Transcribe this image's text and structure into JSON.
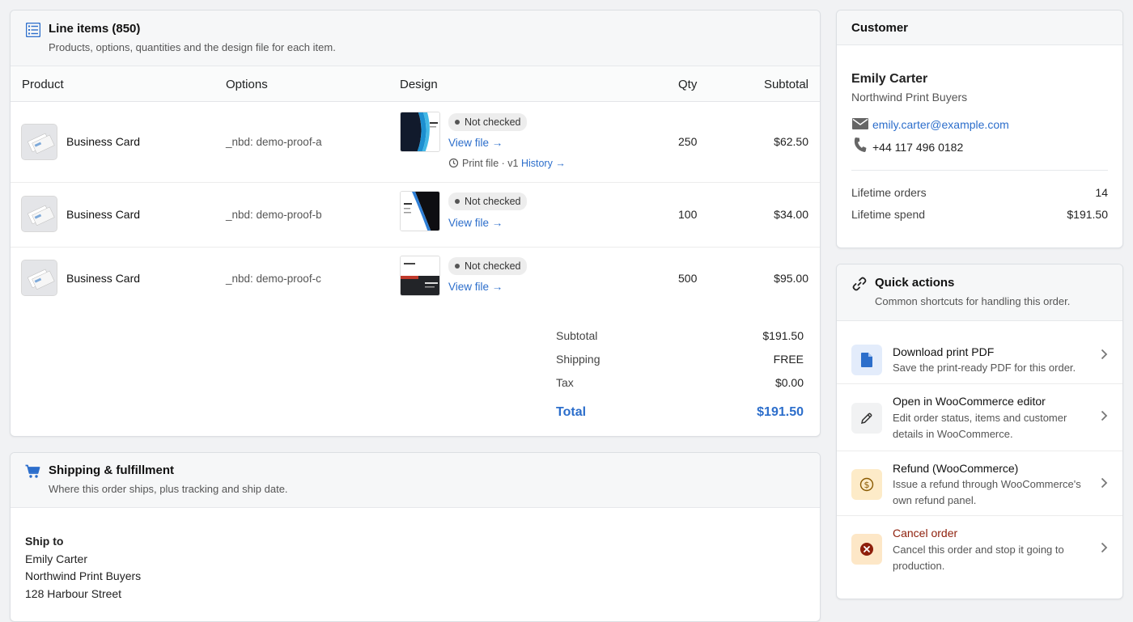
{
  "line_items": {
    "title": "Line items (850)",
    "subtitle": "Products, options, quantities and the design file for each item.",
    "columns": [
      "Product",
      "Options",
      "Design",
      "Qty",
      "Subtotal"
    ],
    "rows": [
      {
        "product": "Business Card",
        "option": "_nbd: demo-proof-a",
        "status": "Not checked",
        "view": "View file →",
        "meta_prefix": "Print file · v1",
        "meta_link": "History →",
        "qty": "250",
        "subtotal": "$62.50"
      },
      {
        "product": "Business Card",
        "option": "_nbd: demo-proof-b",
        "status": "Not checked",
        "view": "View file →",
        "qty": "100",
        "subtotal": "$34.00"
      },
      {
        "product": "Business Card",
        "option": "_nbd: demo-proof-c",
        "status": "Not checked",
        "view": "View file →",
        "qty": "500",
        "subtotal": "$95.00"
      }
    ],
    "totals": {
      "subtotal_label": "Subtotal",
      "subtotal": "$191.50",
      "shipping_label": "Shipping",
      "shipping": "FREE",
      "tax_label": "Tax",
      "tax": "$0.00",
      "total_label": "Total",
      "total": "$191.50"
    }
  },
  "shipping": {
    "title": "Shipping & fulfillment",
    "subtitle": "Where this order ships, plus tracking and ship date.",
    "ship_to_label": "Ship to",
    "lines": [
      "Emily Carter",
      "Northwind Print Buyers",
      "128 Harbour Street"
    ]
  },
  "customer": {
    "title": "Customer",
    "name": "Emily Carter",
    "company": "Northwind Print Buyers",
    "email": "emily.carter@example.com",
    "phone": "+44 117 496 0182",
    "lifetime_orders_label": "Lifetime orders",
    "lifetime_orders": "14",
    "lifetime_spend_label": "Lifetime spend",
    "lifetime_spend": "$191.50"
  },
  "quick_actions": {
    "title": "Quick actions",
    "subtitle": "Common shortcuts for handling this order.",
    "items": [
      {
        "title": "Download print PDF",
        "desc": "Save the print-ready PDF for this order.",
        "icon": "document-icon"
      },
      {
        "title": "Open in WooCommerce editor",
        "desc": "Edit order status, items and customer details in WooCommerce.",
        "icon": "pencil-icon"
      },
      {
        "title": "Refund (WooCommerce)",
        "desc": "Issue a refund through WooCommerce's own refund panel.",
        "icon": "dollar-icon"
      },
      {
        "title": "Cancel order",
        "desc": "Cancel this order and stop it going to production.",
        "icon": "cancel-icon"
      }
    ]
  },
  "colors": {
    "accent": "#2c6ecb",
    "danger": "#8e1f0b",
    "page_bg": "#f1f2f4"
  }
}
